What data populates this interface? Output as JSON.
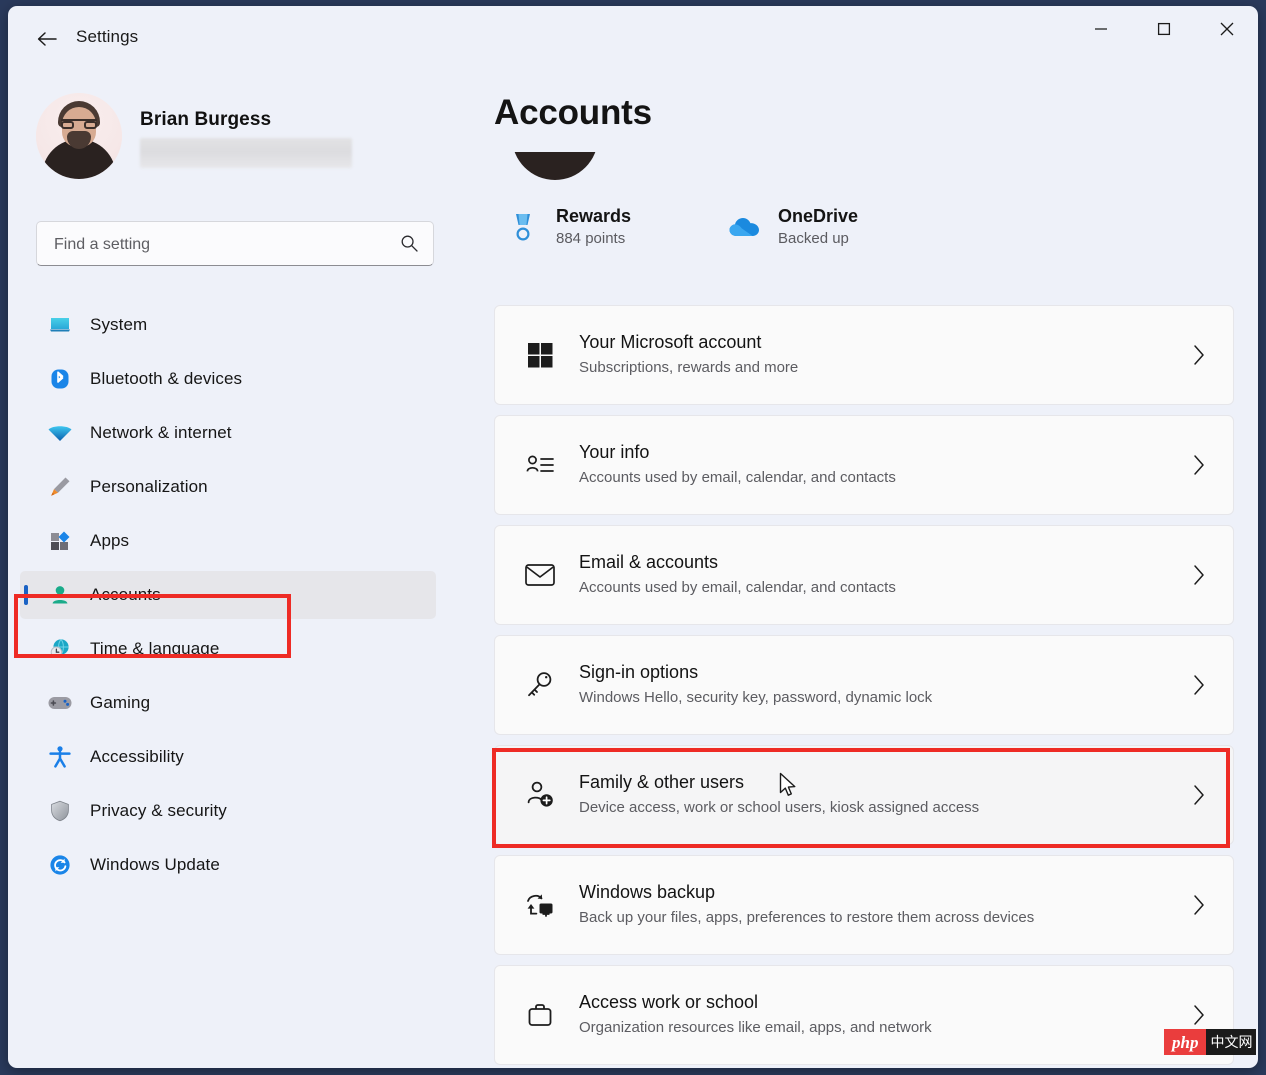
{
  "window": {
    "title": "Settings",
    "back_icon": "back-arrow-icon",
    "minimize_label": "Minimize",
    "maximize_label": "Maximize",
    "close_label": "Close"
  },
  "colors": {
    "window_background": "#eef1f9",
    "card_background": "#fafafa",
    "accent_blue": "#1a62c4",
    "annotation_red": "#ee2b25",
    "selected_nav": "#e6e6ea"
  },
  "sidebar": {
    "profile": {
      "name": "Brian Burgess",
      "email_redacted": true
    },
    "search": {
      "placeholder": "Find a setting",
      "value": "",
      "icon": "search-icon"
    },
    "items": [
      {
        "label": "System",
        "icon": "monitor-icon",
        "selected": false
      },
      {
        "label": "Bluetooth & devices",
        "icon": "bluetooth-icon",
        "selected": false
      },
      {
        "label": "Network & internet",
        "icon": "wifi-icon",
        "selected": false
      },
      {
        "label": "Personalization",
        "icon": "paintbrush-icon",
        "selected": false
      },
      {
        "label": "Apps",
        "icon": "apps-icon",
        "selected": false
      },
      {
        "label": "Accounts",
        "icon": "person-icon",
        "selected": true
      },
      {
        "label": "Time & language",
        "icon": "globe-clock-icon",
        "selected": false
      },
      {
        "label": "Gaming",
        "icon": "gamepad-icon",
        "selected": false
      },
      {
        "label": "Accessibility",
        "icon": "accessibility-icon",
        "selected": false
      },
      {
        "label": "Privacy & security",
        "icon": "shield-icon",
        "selected": false
      },
      {
        "label": "Windows Update",
        "icon": "update-icon",
        "selected": false
      }
    ]
  },
  "main": {
    "page_title": "Accounts",
    "quick_items": [
      {
        "title": "Rewards",
        "subtitle": "884 points",
        "icon": "medal-icon"
      },
      {
        "title": "OneDrive",
        "subtitle": "Backed up",
        "icon": "onedrive-cloud-icon"
      }
    ],
    "cards": [
      {
        "title": "Your Microsoft account",
        "subtitle": "Subscriptions, rewards and more",
        "icon": "windows-logo-icon",
        "highlighted": false
      },
      {
        "title": "Your info",
        "subtitle": "Accounts used by email, calendar, and contacts",
        "icon": "contact-card-icon",
        "highlighted": false
      },
      {
        "title": "Email & accounts",
        "subtitle": "Accounts used by email, calendar, and contacts",
        "icon": "envelope-icon",
        "highlighted": false
      },
      {
        "title": "Sign-in options",
        "subtitle": "Windows Hello, security key, password, dynamic lock",
        "icon": "key-icon",
        "highlighted": false
      },
      {
        "title": "Family & other users",
        "subtitle": "Device access, work or school users, kiosk assigned access",
        "icon": "add-user-icon",
        "highlighted": true
      },
      {
        "title": "Windows backup",
        "subtitle": "Back up your files, apps, preferences to restore them across devices",
        "icon": "backup-icon",
        "highlighted": false
      },
      {
        "title": "Access work or school",
        "subtitle": "Organization resources like email, apps, and network",
        "icon": "briefcase-icon",
        "highlighted": false
      }
    ]
  },
  "annotations": [
    {
      "name": "accounts-nav-highlight",
      "color": "#ee2b25"
    },
    {
      "name": "family-other-users-highlight",
      "color": "#ee2b25"
    }
  ],
  "watermark": {
    "brand": "php",
    "suffix": "中文网"
  }
}
